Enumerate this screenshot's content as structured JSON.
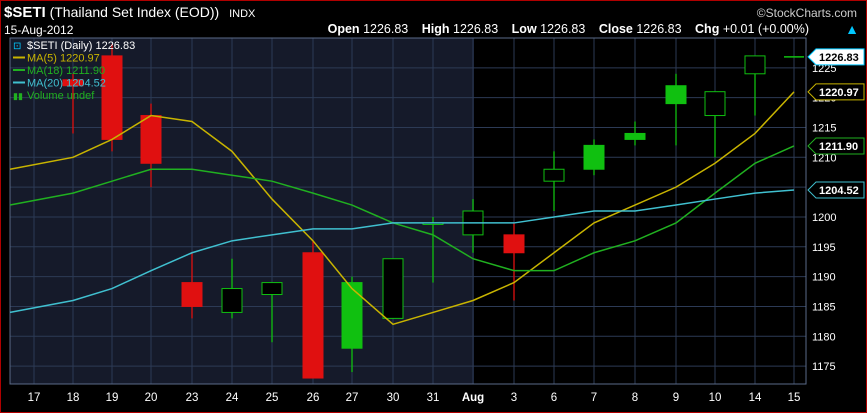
{
  "header": {
    "symbol": "$SETI",
    "name": "(Thailand Set Index (EOD))",
    "exchange": "INDX",
    "date": "15-Aug-2012",
    "brand": "©StockCharts.com",
    "open_label": "Open",
    "open": "1226.83",
    "high_label": "High",
    "high": "1226.83",
    "low_label": "Low",
    "low": "1226.83",
    "close_label": "Close",
    "close": "1226.83",
    "chg_label": "Chg",
    "chg": "+0.01 (+0.00%)",
    "arrow": "▲"
  },
  "legend": [
    {
      "text": "$SETI (Daily) 1226.83",
      "color": "#ffffff"
    },
    {
      "text": "MA(5) 1220.97",
      "color": "#c8b400"
    },
    {
      "text": "MA(18) 1211.90",
      "color": "#20b020"
    },
    {
      "text": "MA(20) 1204.52",
      "color": "#40c0d0"
    },
    {
      "text": "Volume undef",
      "color": "#20b020"
    }
  ],
  "colors": {
    "up": "#10c010",
    "down": "#e01010",
    "upBody": "#000000",
    "ma5": "#c8b400",
    "ma18": "#20b020",
    "ma20": "#40c0d0",
    "plotLeft": "#151a2a",
    "plotRight": "#000000",
    "grid": "#2c3a55",
    "frameRed": "#b00000"
  },
  "chart_data": {
    "type": "candlestick",
    "ylim": [
      1172,
      1230
    ],
    "yticks": [
      1175,
      1180,
      1185,
      1190,
      1195,
      1200,
      1205,
      1210,
      1215,
      1220,
      1225
    ],
    "categories": [
      "17",
      "18",
      "19",
      "20",
      "23",
      "24",
      "25",
      "26",
      "27",
      "30",
      "31",
      "Aug",
      "3",
      "6",
      "7",
      "8",
      "9",
      "10",
      "14",
      "15"
    ],
    "candles": [
      {
        "d": "17",
        "o": null,
        "h": null,
        "l": null,
        "c": null
      },
      {
        "d": "18",
        "o": 1223,
        "h": 1224,
        "l": 1214,
        "c": 1222
      },
      {
        "d": "19",
        "o": 1227,
        "h": 1229,
        "l": 1211,
        "c": 1213
      },
      {
        "d": "20",
        "o": 1217,
        "h": 1219,
        "l": 1205,
        "c": 1209
      },
      {
        "d": "23",
        "o": 1189,
        "h": 1194,
        "l": 1183,
        "c": 1185
      },
      {
        "d": "24",
        "o": 1184,
        "h": 1193,
        "l": 1183,
        "c": 1188
      },
      {
        "d": "25",
        "o": 1187,
        "h": 1189,
        "l": 1179,
        "c": 1189
      },
      {
        "d": "26",
        "o": 1194,
        "h": 1196,
        "l": 1173,
        "c": 1173
      },
      {
        "d": "27",
        "o": 1178,
        "h": 1190,
        "l": 1174,
        "c": 1189
      },
      {
        "d": "30",
        "o": 1183,
        "h": 1193,
        "l": 1183,
        "c": 1193
      },
      {
        "d": "31",
        "o": 1199,
        "h": 1200,
        "l": 1189,
        "c": 1199
      },
      {
        "d": "Aug",
        "o": 1197,
        "h": 1203,
        "l": 1194,
        "c": 1201
      },
      {
        "d": "3",
        "o": 1197,
        "h": 1199,
        "l": 1186,
        "c": 1194
      },
      {
        "d": "6",
        "o": 1206,
        "h": 1211,
        "l": 1201,
        "c": 1208
      },
      {
        "d": "7",
        "o": 1208,
        "h": 1213,
        "l": 1207,
        "c": 1212
      },
      {
        "d": "8",
        "o": 1213,
        "h": 1216,
        "l": 1212,
        "c": 1214
      },
      {
        "d": "9",
        "o": 1219,
        "h": 1224,
        "l": 1212,
        "c": 1222
      },
      {
        "d": "10",
        "o": 1217,
        "h": 1221,
        "l": 1210,
        "c": 1221
      },
      {
        "d": "14",
        "o": 1224,
        "h": 1227,
        "l": 1217,
        "c": 1227
      },
      {
        "d": "15",
        "o": 1226.83,
        "h": 1226.83,
        "l": 1226.83,
        "c": 1226.83
      }
    ],
    "series": [
      {
        "name": "MA(5)",
        "values": [
          1208,
          1210,
          1213,
          1217,
          1216,
          1211,
          1203,
          1196,
          1188,
          1182,
          1184,
          1186,
          1189,
          1194,
          1199,
          1202,
          1205,
          1209,
          1214,
          1220.97
        ]
      },
      {
        "name": "MA(18)",
        "values": [
          1202,
          1204,
          1206,
          1208,
          1208,
          1207,
          1206,
          1204,
          1202,
          1199,
          1197,
          1193,
          1191,
          1191,
          1194,
          1196,
          1199,
          1204,
          1209,
          1211.9
        ]
      },
      {
        "name": "MA(20)",
        "values": [
          1184,
          1186,
          1188,
          1191,
          1194,
          1196,
          1197,
          1198,
          1198,
          1199,
          1199,
          1199,
          1199,
          1200,
          1201,
          1201,
          1202,
          1203,
          1204,
          1204.52
        ]
      }
    ],
    "last_labels": [
      {
        "text": "1226.83",
        "value": 1226.83,
        "style": "price"
      },
      {
        "text": "1220.97",
        "value": 1220.97,
        "style": "ma5"
      },
      {
        "text": "1211.90",
        "value": 1211.9,
        "style": "ma18"
      },
      {
        "text": "1204.52",
        "value": 1204.52,
        "style": "ma20"
      }
    ]
  }
}
